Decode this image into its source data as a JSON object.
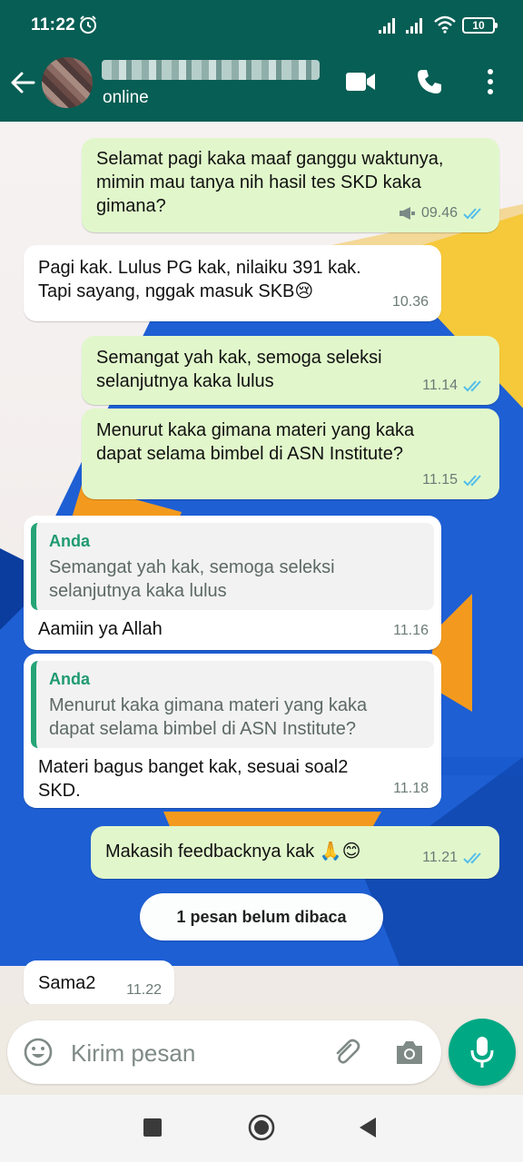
{
  "status_bar": {
    "time": "11:22",
    "battery": "10"
  },
  "header": {
    "status": "online"
  },
  "messages": [
    {
      "text": "Selamat pagi kaka maaf ganggu waktunya,\nmimin mau tanya nih hasil tes SKD kaka\ngimana?",
      "time": "09.46"
    },
    {
      "text": "Pagi kak. Lulus PG kak, nilaiku 391 kak.\nTapi sayang, nggak masuk SKB😢",
      "time": "10.36"
    },
    {
      "text": "Semangat yah kak, semoga seleksi\nselanjutnya kaka lulus",
      "time": "11.14"
    },
    {
      "text": "Menurut kaka gimana materi yang kaka\ndapat selama bimbel di ASN Institute?",
      "time": "11.15"
    },
    {
      "quote_author": "Anda",
      "quote_text": "Semangat yah kak, semoga seleksi\nselanjutnya kaka lulus",
      "text": "Aamiin ya Allah",
      "time": "11.16"
    },
    {
      "quote_author": "Anda",
      "quote_text": "Menurut kaka gimana materi yang kaka\ndapat selama bimbel di ASN Institute?",
      "text": "Materi bagus banget kak, sesuai soal2\nSKD.",
      "time": "11.18"
    },
    {
      "text": "Makasih feedbacknya kak 🙏😊",
      "time": "11.21"
    },
    {
      "text": "Sama2",
      "time": "11.22"
    }
  ],
  "unread_banner": "1 pesan belum dibaca",
  "composer": {
    "placeholder": "Kirim pesan"
  },
  "colors": {
    "header": "#075e54",
    "outgoing_bubble": "#e1f7cb",
    "incoming_bubble": "#ffffff",
    "accent": "#00a884",
    "read_ticks": "#53bdeb",
    "quote_author": "#1f9a72"
  },
  "icons": [
    "alarm-icon",
    "signal-icon",
    "wifi-icon",
    "back-arrow-icon",
    "video-call-icon",
    "phone-icon",
    "more-vert-icon",
    "broadcast-icon",
    "double-check-icon",
    "emoji-icon",
    "attach-icon",
    "camera-icon",
    "mic-icon",
    "nav-recents-icon",
    "nav-home-icon",
    "nav-back-icon"
  ]
}
